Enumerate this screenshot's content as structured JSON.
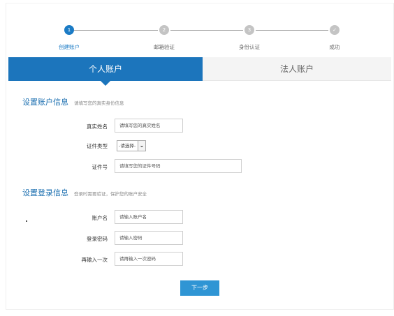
{
  "steps": [
    {
      "number": "1",
      "label": "创建账户",
      "active": true
    },
    {
      "number": "2",
      "label": "邮箱验证",
      "active": false
    },
    {
      "number": "3",
      "label": "身份认证",
      "active": false
    },
    {
      "number": "✓",
      "label": "成功",
      "active": false
    }
  ],
  "tabs": {
    "personal": "个人账户",
    "corporate": "法人账户"
  },
  "account_info": {
    "title": "设置账户信息",
    "hint": "请填写您的真实身份信息",
    "real_name_label": "真实姓名",
    "real_name_placeholder": "请填写您的真实姓名",
    "id_type_label": "证件类型",
    "id_type_value": "-请选择-",
    "id_number_label": "证件号",
    "id_number_placeholder": "请填写您的证件号码"
  },
  "login_info": {
    "title": "设置登录信息",
    "hint": "登录时需要验证，保护您的账户安全",
    "account_label": "账户名",
    "account_placeholder": "请输入账户名",
    "password_label": "登录密码",
    "password_placeholder": "请输入密码",
    "confirm_label": "再输入一次",
    "confirm_placeholder": "请再输入一次密码"
  },
  "next_button": "下一步",
  "colors": {
    "accent": "#1c75bc",
    "button": "#2f95d4",
    "inactive_step": "#c4c4c4"
  }
}
